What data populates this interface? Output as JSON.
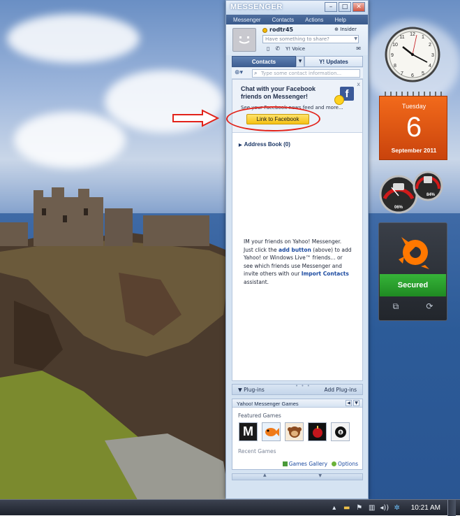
{
  "messenger": {
    "title": "MESSENGER",
    "menu": [
      "Messenger",
      "Contacts",
      "Actions",
      "Help"
    ],
    "window_buttons": {
      "minimize": "–",
      "maximize": "□",
      "close": "✕"
    },
    "profile": {
      "username": "rodtr45",
      "insider_label": "Insider",
      "status_placeholder": "Have something to share?",
      "voice_label": "Y! Voice"
    },
    "tabs": [
      {
        "label": "Contacts",
        "active": true
      },
      {
        "label": "Y! Updates",
        "active": false
      }
    ],
    "search_placeholder": "Type some contact information...",
    "facebook_promo": {
      "title": "Chat with your Facebook friends on Messenger!",
      "description": "See your Facebook news feed and more...",
      "button_label": "Link to Facebook",
      "close": "x"
    },
    "address_book_label": "Address Book (0)",
    "help_text": {
      "part1": "IM your friends on Yahoo! Messenger. Just click the ",
      "link1": "add button",
      "part2": " (above) to add Yahoo! or Windows Live™ friends... or see which friends use Messenger and invite others with our ",
      "link2": "Import Contacts",
      "part3": " assistant."
    },
    "plugins": {
      "label": "Plug-ins",
      "add_label": "Add Plug-ins"
    },
    "games": {
      "title": "Yahoo! Messenger Games",
      "featured_label": "Featured Games",
      "featured_icons": [
        "mahjong-m",
        "fish",
        "monkey",
        "bomb",
        "8-ball"
      ],
      "recent_label": "Recent Games",
      "gallery_link": "Games Gallery",
      "options_link": "Options"
    }
  },
  "gadgets": {
    "calendar": {
      "weekday": "Tuesday",
      "day": "6",
      "month_year": "September 2011"
    },
    "meters": {
      "cpu_label": "06%",
      "memory_label": "84%"
    },
    "avast": {
      "status": "Secured"
    }
  },
  "taskbar": {
    "time": "10:21 AM",
    "tray_icons": [
      "show-hidden",
      "folder",
      "flag",
      "network",
      "volume",
      "app"
    ]
  },
  "colors": {
    "accent": "#3e5f93",
    "facebook": "#3b5998",
    "annotation": "#e2231a",
    "avast_green": "#36b439",
    "calendar_orange": "#f26a1b"
  }
}
